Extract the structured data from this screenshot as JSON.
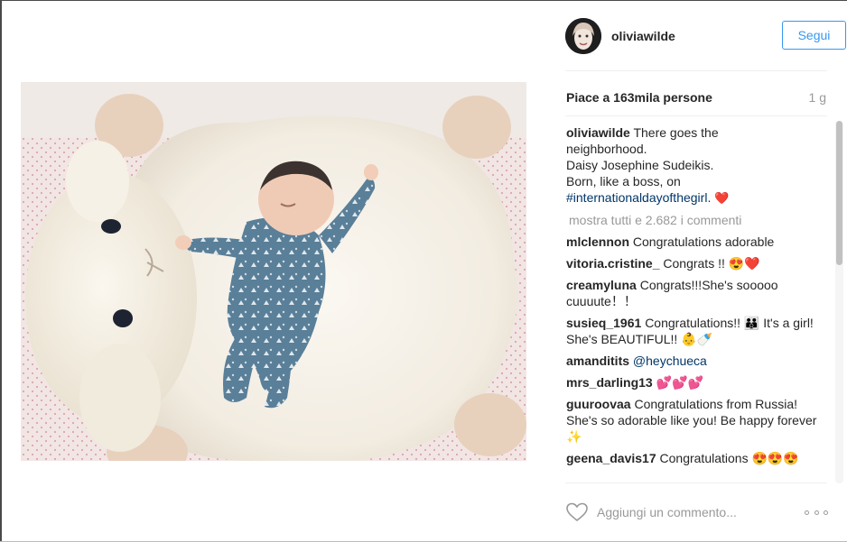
{
  "post": {
    "username": "oliviawilde",
    "follow_label": "Segui",
    "likes": "Piace a 163mila persone",
    "time": "1 g",
    "caption": {
      "username": "oliviawilde",
      "lines": [
        "There goes the",
        "neighborhood.",
        "Daisy Josephine Sudeikis.",
        "Born, like a boss, on"
      ],
      "hashtag": "#internationaldayofthegirl.",
      "emoji": "❤️"
    },
    "load_more": "mostra tutti e 2.682 i commenti",
    "comments": [
      {
        "user": "mlclennon",
        "text": "Congratulations adorable"
      },
      {
        "user": "vitoria.cristine_",
        "text": "Congrats !! 😍❤️"
      },
      {
        "user": "creamyluna",
        "text": "Congrats!!!She's sooooo cuuuute！！"
      },
      {
        "user": "susieq_1961",
        "text": "Congratulations!! 👪 It's a girl! She's BEAUTIFUL!! 👶🍼"
      },
      {
        "user": "amanditits",
        "text": "@heychueca"
      },
      {
        "user": "mrs_darling13",
        "text": "💕💕💕"
      },
      {
        "user": "guuroovaa",
        "text": "Congratulations from Russia! She's so adorable like you! Be happy forever ✨"
      },
      {
        "user": "geena_davis17",
        "text": "Congratulations 😍😍😍"
      }
    ],
    "comment_placeholder": "Aggiungi un commento...",
    "accent_color": "#3897f0"
  }
}
